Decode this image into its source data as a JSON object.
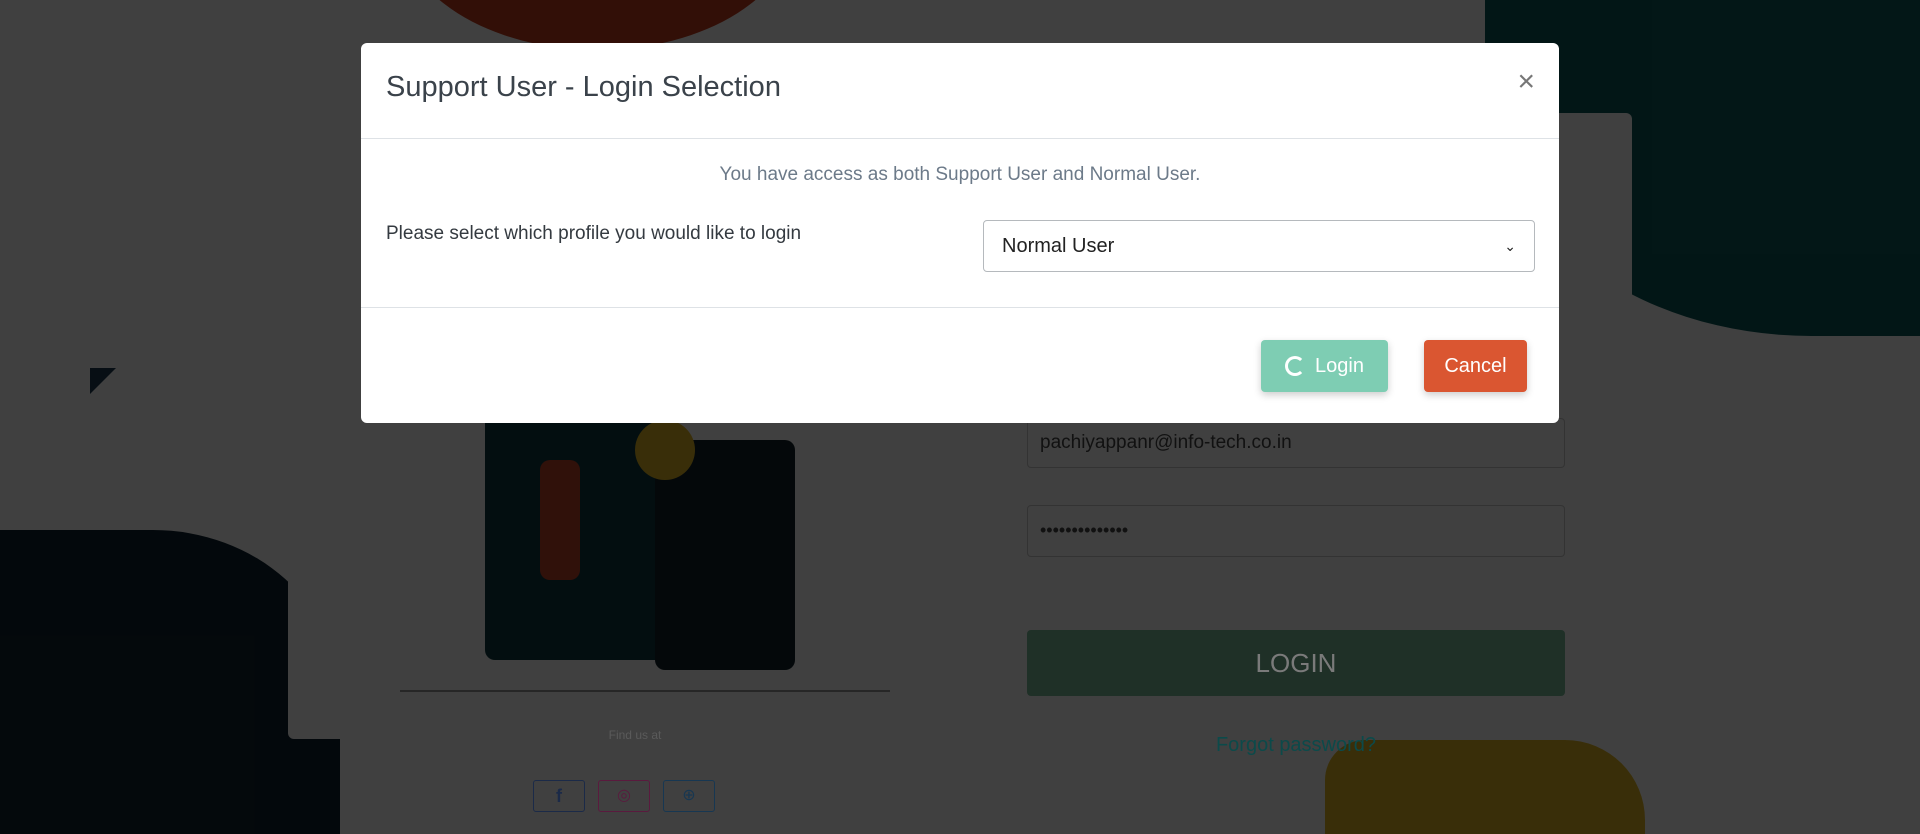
{
  "modal": {
    "title": "Support User - Login Selection",
    "info": "You have access as both Support User and Normal User.",
    "prompt": "Please select which profile you would like to login",
    "selected_profile": "Normal User",
    "login_label": "Login",
    "cancel_label": "Cancel"
  },
  "background": {
    "email": "pachiyappanr@info-tech.co.in",
    "password_masked": "••••••••••••••",
    "login_label": "LOGIN",
    "forgot": "Forgot password?",
    "find_us": "Find us at"
  },
  "colors": {
    "teal": "#7ecdb3",
    "cancel": "#da5631",
    "brand_teal": "#0a6b6b"
  }
}
